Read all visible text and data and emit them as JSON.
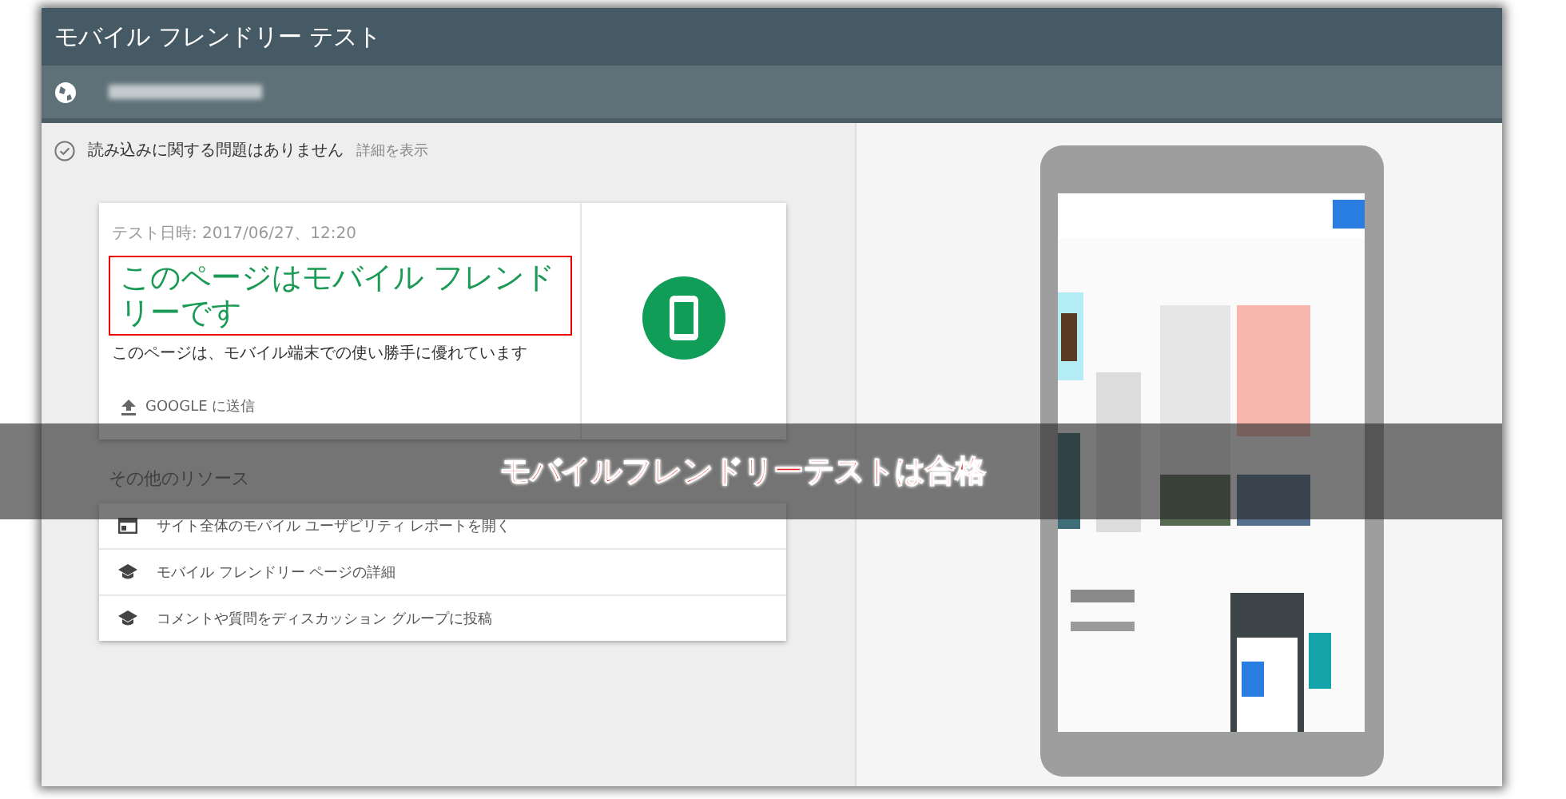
{
  "window": {
    "title": "モバイル フレンドリー テスト"
  },
  "url_bar": {
    "redacted": true
  },
  "status": {
    "message": "読み込みに関する問題はありません",
    "link": "詳細を表示"
  },
  "result": {
    "date": "テスト日時: 2017/06/27、12:20",
    "headline": "このページはモバイル フレンドリーです",
    "highlighted": true,
    "description": "このページは、モバイル端末での使い勝手に優れています",
    "submit": "GOOGLE に送信"
  },
  "resources": {
    "heading": "その他のリソース",
    "items": [
      {
        "kind": "report",
        "label": "サイト全体のモバイル ユーザビリティ レポートを開く"
      },
      {
        "kind": "learn",
        "label": "モバイル フレンドリー ページの詳細"
      },
      {
        "kind": "learn",
        "label": "コメントや質問をディスカッション グループに投稿"
      }
    ]
  },
  "banner": {
    "text": "モバイルフレンドリーテストは合格"
  }
}
